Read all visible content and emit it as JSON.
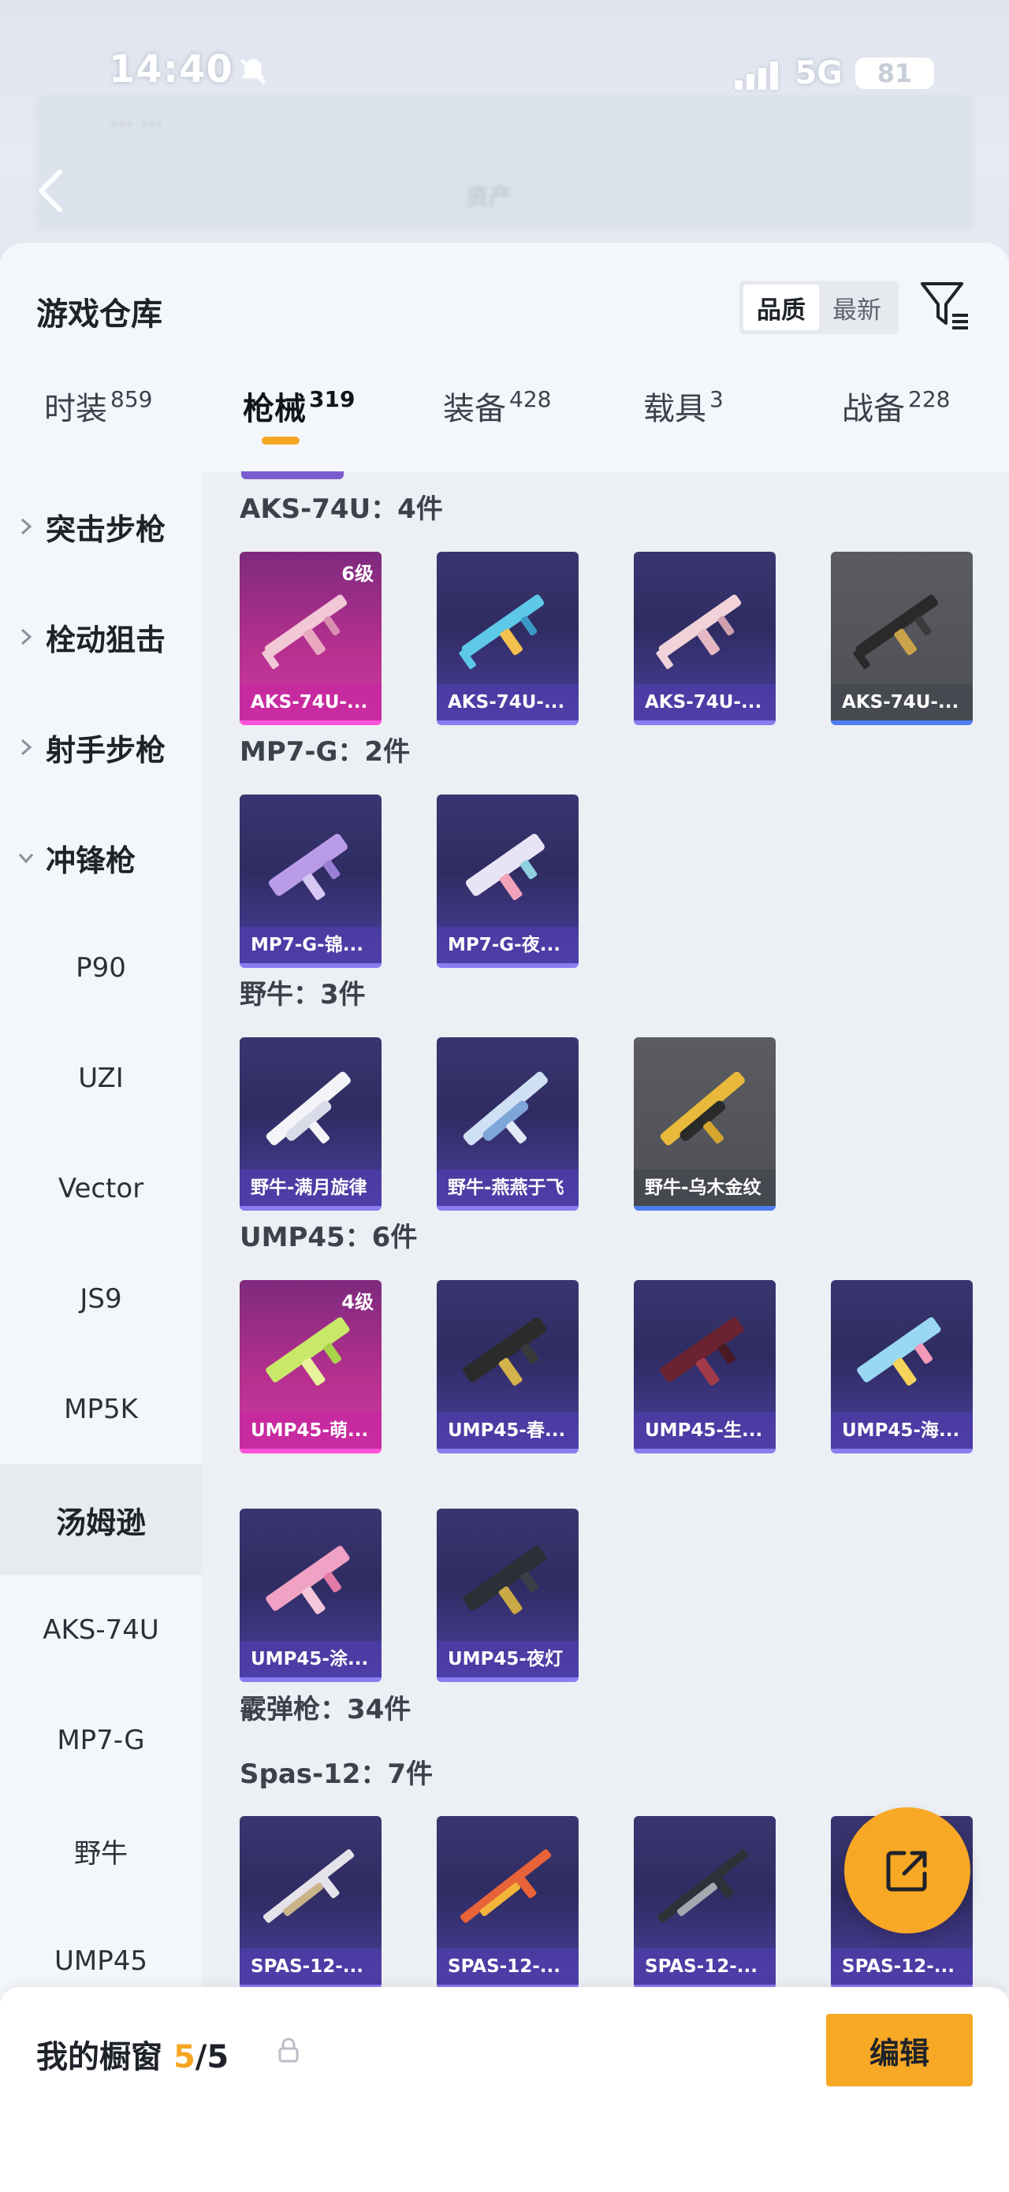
{
  "status_bar": {
    "time": "14:40",
    "network": "5G",
    "battery": "81"
  },
  "sheet": {
    "title": "游戏仓库",
    "sort_options": [
      {
        "label": "品质",
        "active": true
      },
      {
        "label": "最新",
        "active": false
      }
    ]
  },
  "tabs": [
    {
      "label": "时装",
      "count": "859"
    },
    {
      "label": "枪械",
      "count": "319",
      "active": true
    },
    {
      "label": "装备",
      "count": "428"
    },
    {
      "label": "载具",
      "count": "3"
    },
    {
      "label": "战备",
      "count": "228"
    }
  ],
  "sidebar": {
    "categories": [
      "突击步枪",
      "栓动狙击",
      "射手步枪",
      "冲锋枪"
    ],
    "items": [
      "P90",
      "UZI",
      "Vector",
      "JS9",
      "MP5K",
      "汤姆逊",
      "AKS-74U",
      "MP7-G",
      "野牛",
      "UMP45"
    ],
    "selected": "汤姆逊"
  },
  "groups": [
    {
      "title": "AKS-74U：4件",
      "items": [
        {
          "label": "AKS-74U-...",
          "level": "6级",
          "rarity": "pink"
        },
        {
          "label": "AKS-74U-...",
          "rarity": "purple"
        },
        {
          "label": "AKS-74U-...",
          "rarity": "purple"
        },
        {
          "label": "AKS-74U-...",
          "rarity": "gray"
        }
      ]
    },
    {
      "title": "MP7-G：2件",
      "items": [
        {
          "label": "MP7-G-锦...",
          "rarity": "purple"
        },
        {
          "label": "MP7-G-夜...",
          "rarity": "purple"
        }
      ]
    },
    {
      "title": "野牛：3件",
      "items": [
        {
          "label": "野牛-满月旋律",
          "rarity": "purple"
        },
        {
          "label": "野牛-燕燕于飞",
          "rarity": "purple"
        },
        {
          "label": "野牛-乌木金纹",
          "rarity": "gray"
        }
      ]
    },
    {
      "title": "UMP45：6件",
      "items": [
        {
          "label": "UMP45-萌...",
          "level": "4级",
          "rarity": "pink"
        },
        {
          "label": "UMP45-春...",
          "rarity": "purple"
        },
        {
          "label": "UMP45-生...",
          "rarity": "purple"
        },
        {
          "label": "UMP45-海...",
          "rarity": "purple"
        },
        {
          "label": "UMP45-涂...",
          "rarity": "purple"
        },
        {
          "label": "UMP45-夜灯",
          "rarity": "purple"
        }
      ]
    },
    {
      "title": "霰弹枪：34件",
      "items": []
    },
    {
      "title": "Spas-12：7件",
      "items": [
        {
          "label": "SPAS-12-...",
          "rarity": "purple"
        },
        {
          "label": "SPAS-12-...",
          "rarity": "purple"
        },
        {
          "label": "SPAS-12-...",
          "rarity": "purple"
        },
        {
          "label": "SPAS-12-...",
          "rarity": "purple"
        }
      ]
    }
  ],
  "bottom_bar": {
    "title": "我的橱窗",
    "count_current": "5",
    "count_total": "/5",
    "edit_label": "编辑"
  },
  "colors": {
    "accent": "#f7a825",
    "pink_rarity": "#cd3aa8",
    "purple_rarity": "#4b3f9c",
    "gray_rarity": "#55575d"
  }
}
